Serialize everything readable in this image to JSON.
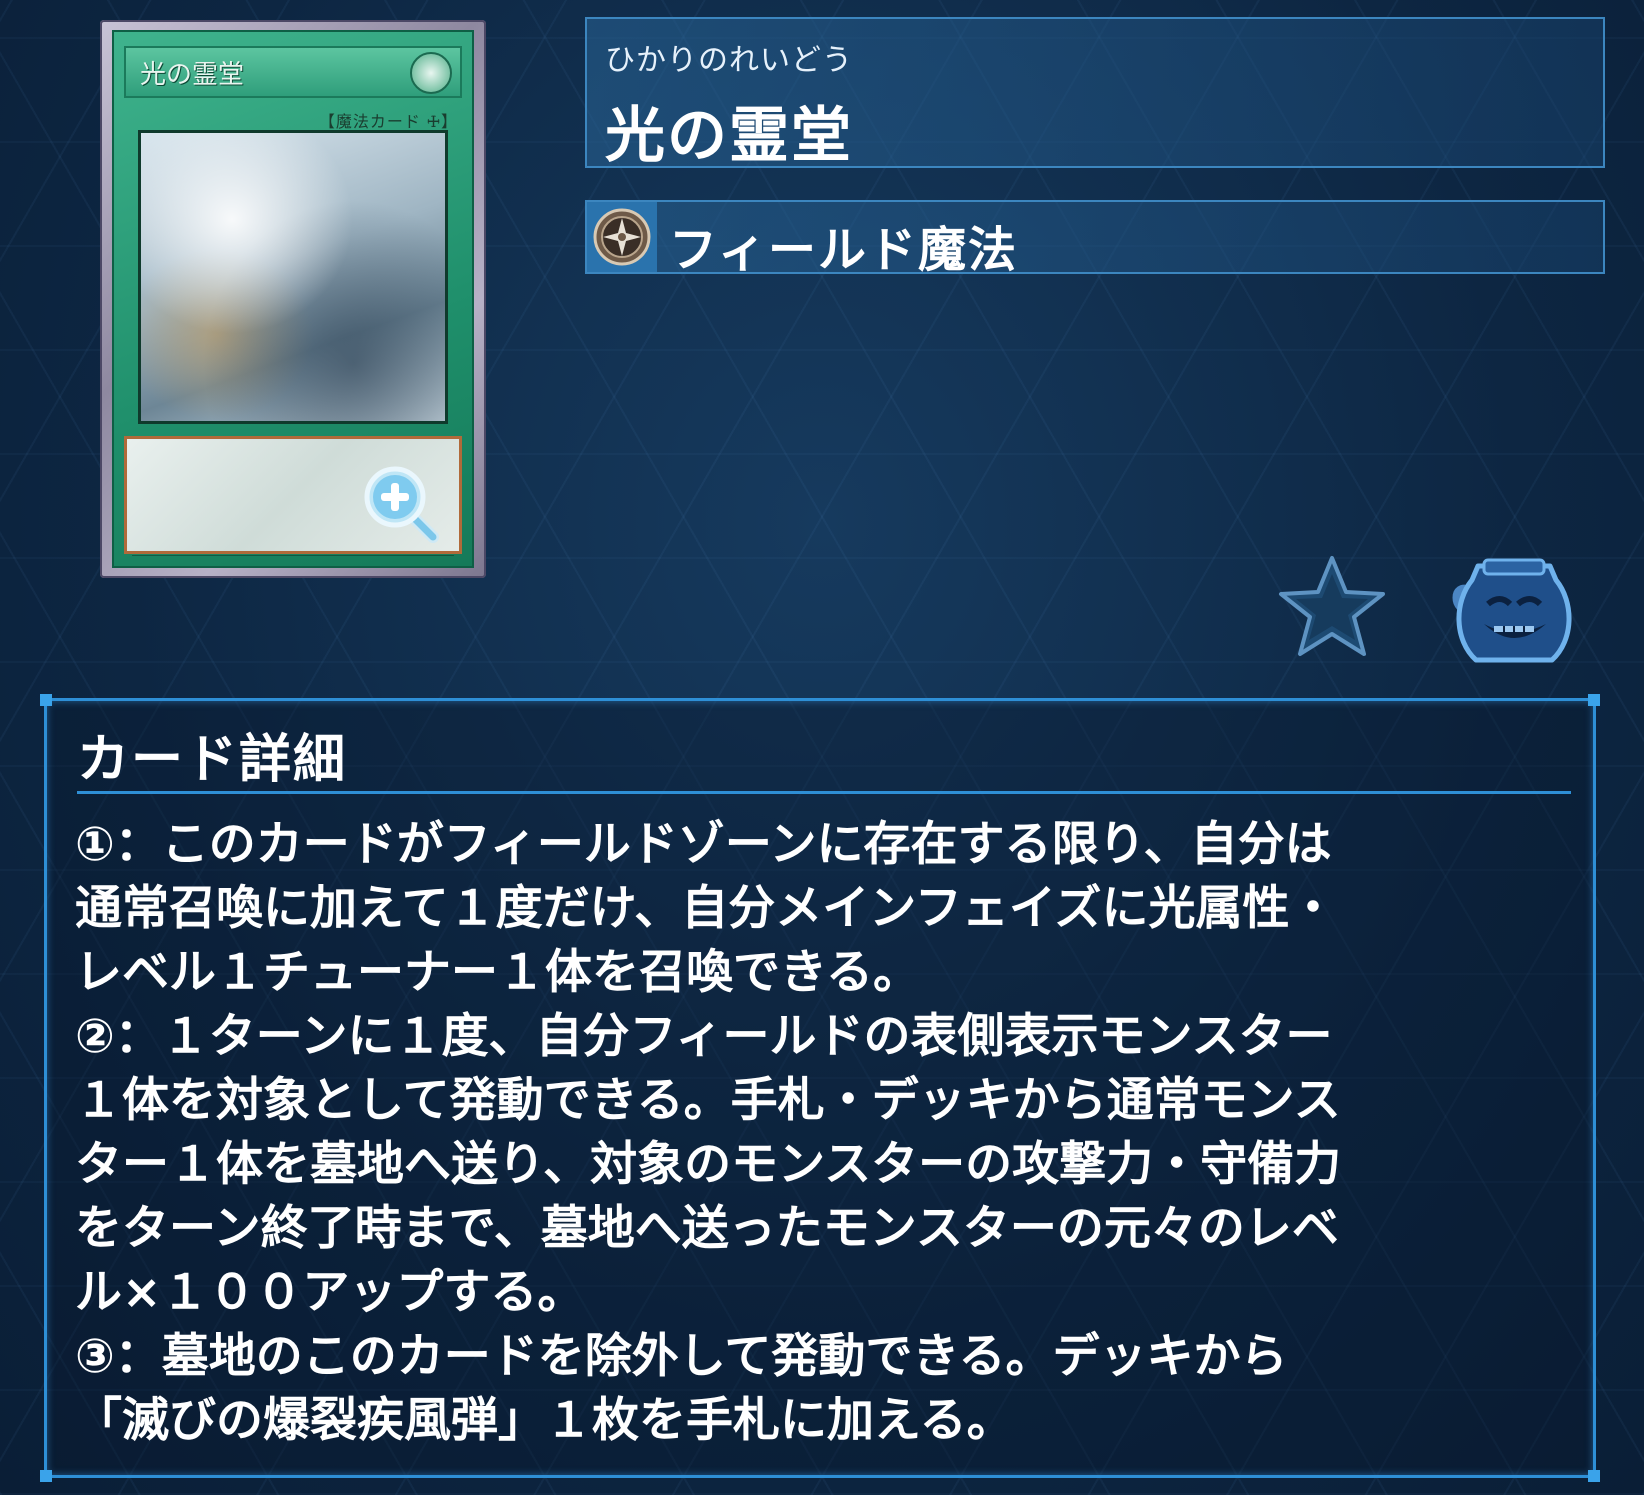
{
  "card": {
    "image_name": "光の霊堂",
    "image_type_line": "【魔法カード 🜊】",
    "ruby": "ひかりのれいどう",
    "name": "光の霊堂",
    "type": "フィールド魔法"
  },
  "icons": {
    "zoom": "zoom-in-icon",
    "type": "field-spell-icon",
    "favorite": "star-icon",
    "pot": "pot-of-greed-icon"
  },
  "detail": {
    "title": "カード詳細",
    "text": "①：このカードがフィールドゾーンに存在する限り、自分は\n通常召喚に加えて１度だけ、自分メインフェイズに光属性・\nレベル１チューナー１体を召喚できる。\n②：１ターンに１度、自分フィールドの表側表示モンスター\n１体を対象として発動できる。手札・デッキから通常モンス\nター１体を墓地へ送り、対象のモンスターの攻撃力・守備力\nをターン終了時まで、墓地へ送ったモンスターの元々のレベ\nル×１００アップする。\n③：墓地のこのカードを除外して発動できる。デッキから\n「滅びの爆裂疾風弾」１枚を手札に加える。"
  },
  "colors": {
    "background": "#0d2642",
    "panel_border": "#3c86bf",
    "spell_green": "#1f8f6b"
  }
}
